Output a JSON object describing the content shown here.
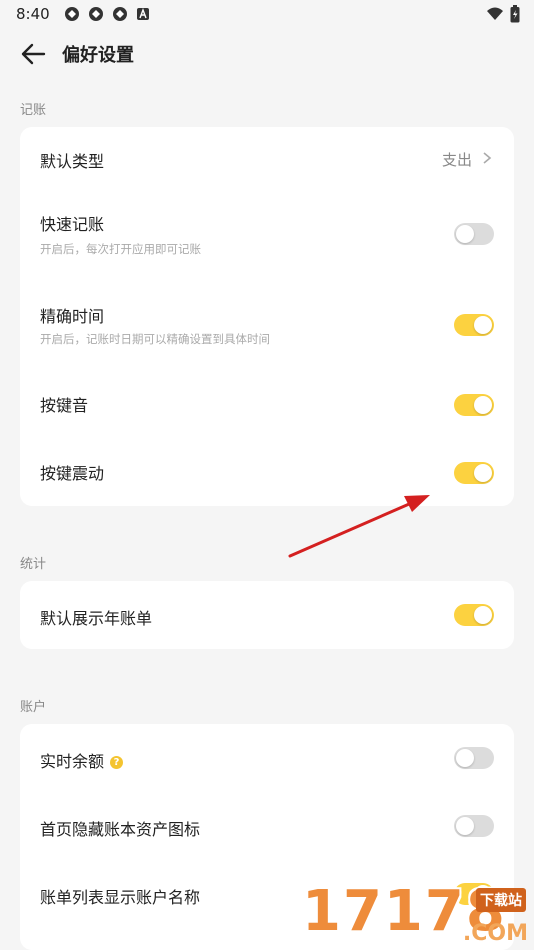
{
  "status": {
    "time": "8:40"
  },
  "header": {
    "title": "偏好设置"
  },
  "sections": {
    "bookkeeping": {
      "title": "记账",
      "default_type": {
        "label": "默认类型",
        "value": "支出"
      },
      "quick_entry": {
        "label": "快速记账",
        "sub": "开启后，每次打开应用即可记账",
        "on": false
      },
      "precise_time": {
        "label": "精确时间",
        "sub": "开启后，记账时日期可以精确设置到具体时间",
        "on": true
      },
      "key_sound": {
        "label": "按键音",
        "on": true
      },
      "key_vibrate": {
        "label": "按键震动",
        "on": true
      }
    },
    "stats": {
      "title": "统计",
      "default_year_bill": {
        "label": "默认展示年账单",
        "on": true
      }
    },
    "account": {
      "title": "账户",
      "realtime_balance": {
        "label": "实时余额",
        "help": "?",
        "on": false
      },
      "hide_asset_icon": {
        "label": "首页隐藏账本资产图标",
        "on": false
      },
      "show_account_name": {
        "label": "账单列表显示账户名称",
        "on": true
      }
    }
  },
  "watermark": {
    "digits": "17178",
    "label": "下载站",
    "suffix": ".COM"
  },
  "colors": {
    "accent": "#fcd240",
    "toggle_off": "#dcdcdc",
    "background": "#f5f5f5"
  }
}
